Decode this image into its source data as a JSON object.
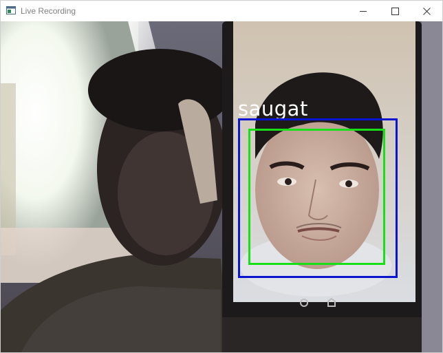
{
  "window": {
    "title": "Live Recording",
    "controls": {
      "minimize_icon": "minimize-icon",
      "maximize_icon": "maximize-icon",
      "close_icon": "close-icon"
    }
  },
  "detection": {
    "name_label": "saugat",
    "outer_box_color": "#0a14d0",
    "face_box_color": "#18e018",
    "label_color": "#ffffff"
  }
}
